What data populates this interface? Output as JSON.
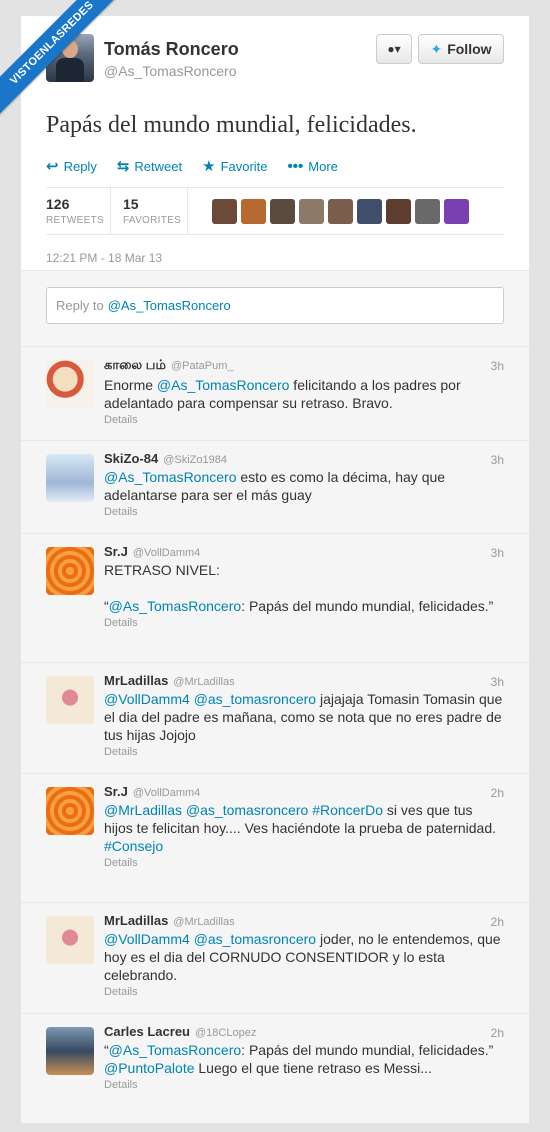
{
  "ribbon": {
    "text": "VISTOENLASREDES"
  },
  "header": {
    "name": "Tomás Roncero",
    "handle": "@As_TomasRoncero",
    "user_menu_icon": "user-dropdown-icon",
    "follow_label": "Follow"
  },
  "tweet": {
    "text": "Papás del mundo mundial, felicidades.",
    "actions": {
      "reply": "Reply",
      "retweet": "Retweet",
      "favorite": "Favorite",
      "more": "More"
    },
    "retweets": "126",
    "retweets_label": "RETWEETS",
    "favorites": "15",
    "favorites_label": "FAVORITES",
    "timestamp": "12:21 PM - 18 Mar 13",
    "favoriter_colors": [
      "#6b4a3a",
      "#b8692f",
      "#5a4b3f",
      "#8c7a66",
      "#7b5f4c",
      "#3f4f6b",
      "#5d3d2e",
      "#6a6a6a",
      "#7a3fb0"
    ]
  },
  "reply_box": {
    "placeholder": "Reply to",
    "mention": "@As_TomasRoncero"
  },
  "replies": [
    {
      "name": "காலை பம்",
      "handle": "@PataPum_",
      "time": "3h",
      "pre": "Enorme ",
      "mention": "@As_TomasRoncero",
      "post": " felicitando a los padres por adelantado para compensar su retraso. Bravo.",
      "details": "Details"
    },
    {
      "name": "SkiZo-84",
      "handle": "@SkiZo1984",
      "time": "3h",
      "mention": "@As_TomasRoncero",
      "post": " esto es como la décima, hay que adelantarse para ser el más guay",
      "details": "Details"
    },
    {
      "name": "Sr.J",
      "handle": "@VollDamm4",
      "time": "3h",
      "line1": "RETRASO NIVEL:",
      "quote_open": "“",
      "mention": "@As_TomasRoncero",
      "post": ": Papás del mundo mundial, felicidades.”",
      "details": "Details"
    },
    {
      "name": "MrLadillas",
      "handle": "@MrLadillas",
      "time": "3h",
      "m1": "@VollDamm4",
      "m2": "@as_tomasroncero",
      "post": " jajajaja Tomasin Tomasin que el dia del padre es mañana, como se nota que no eres padre de tus hijas Jojojo",
      "details": "Details"
    },
    {
      "name": "Sr.J",
      "handle": "@VollDamm4",
      "time": "2h",
      "m1": "@MrLadillas",
      "m2": "@as_tomasroncero",
      "m3": "#RoncerDo",
      "post": " si ves que tus hijos te felicitan hoy.... Ves haciéndote la prueba de paternidad.",
      "tag": "#Consejo",
      "details": "Details"
    },
    {
      "name": "MrLadillas",
      "handle": "@MrLadillas",
      "time": "2h",
      "m1": "@VollDamm4",
      "m2": "@as_tomasroncero",
      "post": " joder, no le entendemos, que hoy es el dia del CORNUDO CONSENTIDOR y lo esta celebrando.",
      "details": "Details"
    },
    {
      "name": "Carles Lacreu",
      "handle": "@18CLopez",
      "time": "2h",
      "quote_open": "“",
      "mention": "@As_TomasRoncero",
      "mid": ": Papás del mundo mundial, felicidades.” ",
      "m2": "@PuntoPalote",
      "post": " Luego el que tiene retraso es Messi...",
      "details": "Details"
    }
  ]
}
